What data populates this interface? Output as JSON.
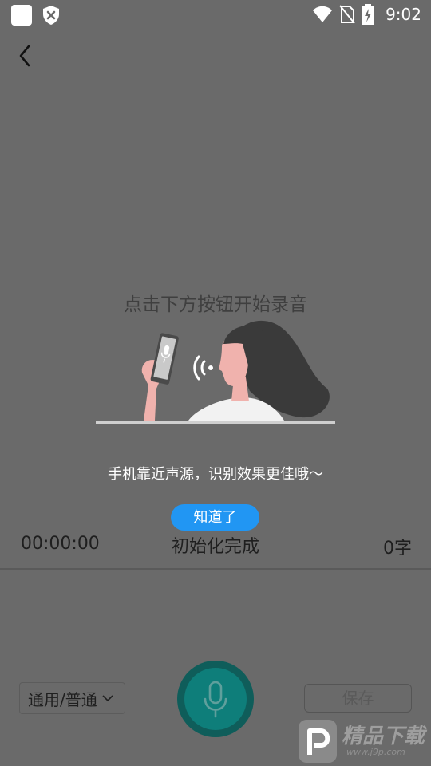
{
  "status_bar": {
    "time": "9:02",
    "icons": [
      "app-square-icon",
      "shield-x-icon",
      "wifi-icon",
      "no-sim-icon",
      "battery-charging-icon"
    ]
  },
  "nav": {
    "back_icon": "chevron-left-icon"
  },
  "hint": {
    "title": "点击下方按钮开始录音",
    "tip": "手机靠近声源，识别效果更佳哦～",
    "ok_label": "知道了"
  },
  "recording": {
    "timer": "00:00:00",
    "status": "初始化完成",
    "char_count": "0字"
  },
  "controls": {
    "language_mode": "通用/普通",
    "mic_icon": "microphone-icon",
    "save_label": "保存"
  },
  "watermark": {
    "text": "精品下载",
    "url": "www.j9p.com"
  },
  "colors": {
    "overlay": "#6a6a6a",
    "accent_blue": "#2196f3",
    "mic_teal": "#0e7e7a"
  }
}
